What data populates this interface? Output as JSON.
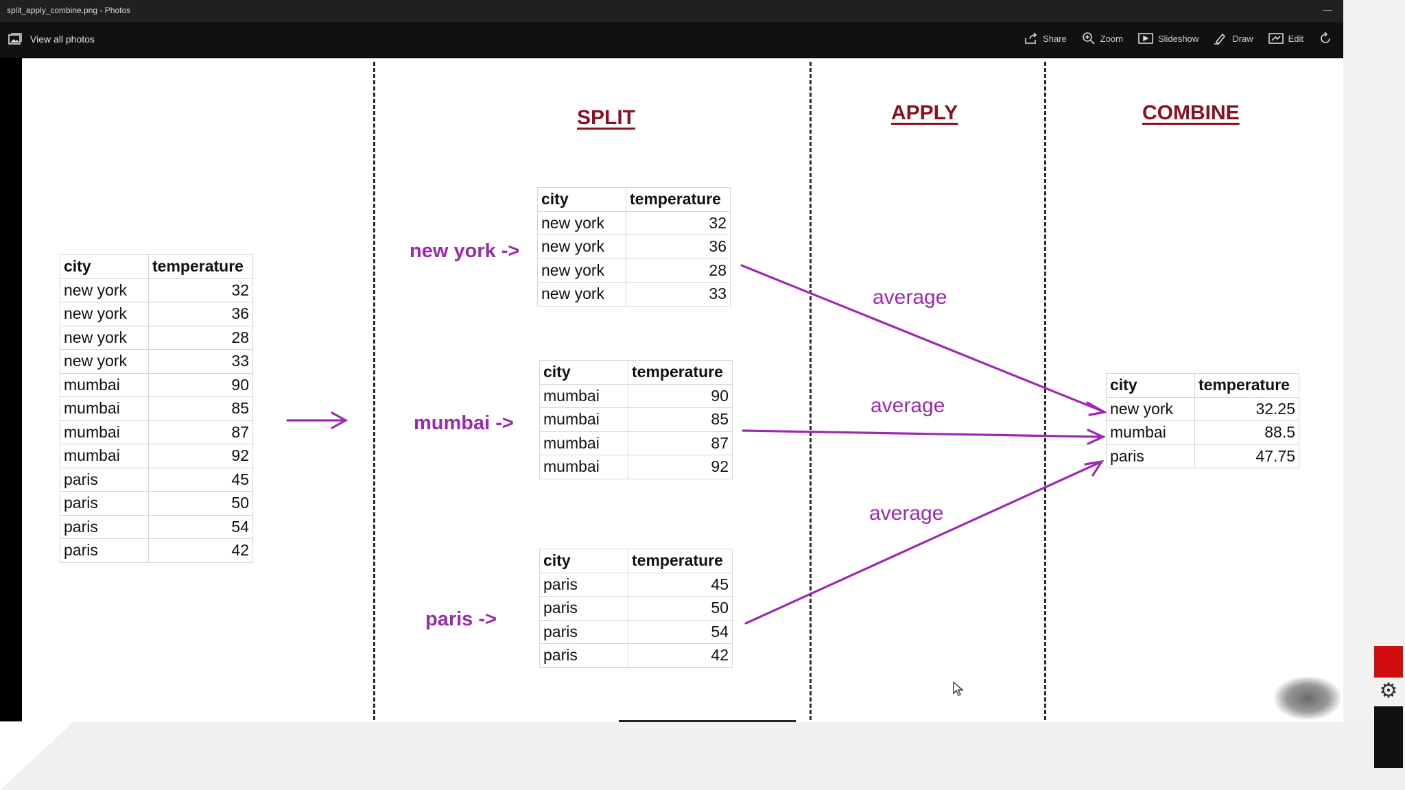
{
  "window": {
    "title": "split_apply_combine.png - Photos",
    "minimize_glyph": "—",
    "view_all_label": "View all photos",
    "tools": [
      {
        "icon": "share-icon",
        "label": "Share"
      },
      {
        "icon": "zoom-icon",
        "label": "Zoom"
      },
      {
        "icon": "slideshow-icon",
        "label": "Slideshow"
      },
      {
        "icon": "draw-icon",
        "label": "Draw"
      },
      {
        "icon": "edit-icon",
        "label": "Edit"
      },
      {
        "icon": "rotate-icon",
        "label": ""
      }
    ]
  },
  "diagram": {
    "headings": {
      "split": "SPLIT",
      "apply": "APPLY",
      "combine": "COMBINE"
    },
    "columns": {
      "city": "city",
      "temperature": "temperature"
    },
    "source_table": [
      [
        "new york",
        "32"
      ],
      [
        "new york",
        "36"
      ],
      [
        "new york",
        "28"
      ],
      [
        "new york",
        "33"
      ],
      [
        "mumbai",
        "90"
      ],
      [
        "mumbai",
        "85"
      ],
      [
        "mumbai",
        "87"
      ],
      [
        "mumbai",
        "92"
      ],
      [
        "paris",
        "45"
      ],
      [
        "paris",
        "50"
      ],
      [
        "paris",
        "54"
      ],
      [
        "paris",
        "42"
      ]
    ],
    "groups": [
      {
        "label": "new york ->",
        "apply": "average",
        "rows": [
          [
            "new york",
            "32"
          ],
          [
            "new york",
            "36"
          ],
          [
            "new york",
            "28"
          ],
          [
            "new york",
            "33"
          ]
        ]
      },
      {
        "label": "mumbai ->",
        "apply": "average",
        "rows": [
          [
            "mumbai",
            "90"
          ],
          [
            "mumbai",
            "85"
          ],
          [
            "mumbai",
            "87"
          ],
          [
            "mumbai",
            "92"
          ]
        ]
      },
      {
        "label": "paris ->",
        "apply": "average",
        "rows": [
          [
            "paris",
            "45"
          ],
          [
            "paris",
            "50"
          ],
          [
            "paris",
            "54"
          ],
          [
            "paris",
            "42"
          ]
        ]
      }
    ],
    "result_table": [
      [
        "new york",
        "32.25"
      ],
      [
        "mumbai",
        "88.5"
      ],
      [
        "paris",
        "47.75"
      ]
    ],
    "arrow_color": "#9c2ab0",
    "heading_color": "#8c1020"
  },
  "overlay": {
    "gear_icon": "⚙",
    "record_color": "#d10d0d"
  }
}
